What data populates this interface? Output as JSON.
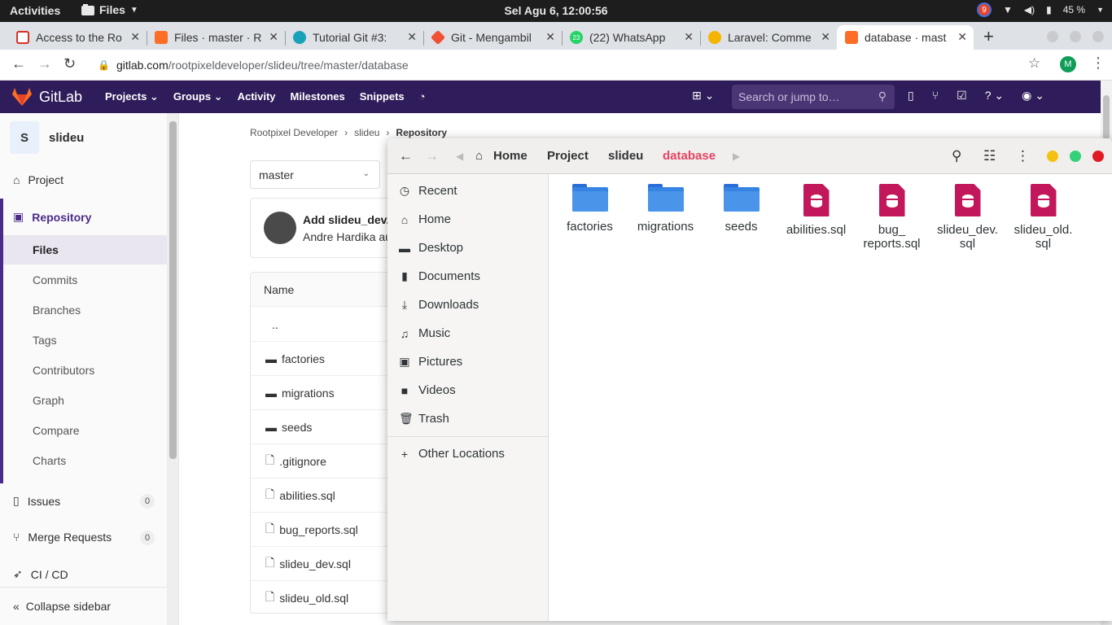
{
  "system_bar": {
    "activities": "Activities",
    "app_menu": "Files",
    "clock": "Sel Agu  6, 12:00:56",
    "notification_count": "9",
    "battery": "45 %"
  },
  "browser": {
    "tabs": [
      {
        "title": "Access to the Ro"
      },
      {
        "title": "Files · master · R"
      },
      {
        "title": "Tutorial Git #3:"
      },
      {
        "title": "Git - Mengambil"
      },
      {
        "title": "(22) WhatsApp"
      },
      {
        "title": "Laravel: Comme"
      },
      {
        "title": "database · mast"
      }
    ],
    "whatsapp_badge": "23",
    "url_host": "gitlab.com",
    "url_path": "/rootpixeldeveloper/slideu/tree/master/database",
    "profile_initial": "M"
  },
  "gitlab": {
    "brand": "GitLab",
    "nav": [
      "Projects",
      "Groups",
      "Activity",
      "Milestones",
      "Snippets"
    ],
    "search_placeholder": "Search or jump to…",
    "project_initial": "S",
    "project_name": "slideu",
    "sidebar": {
      "project": "Project",
      "repository": "Repository",
      "sub": [
        "Files",
        "Commits",
        "Branches",
        "Tags",
        "Contributors",
        "Graph",
        "Compare",
        "Charts"
      ],
      "issues": "Issues",
      "issues_count": "0",
      "merge_requests": "Merge Requests",
      "mr_count": "0",
      "cicd": "CI / CD",
      "collapse": "Collapse sidebar"
    },
    "breadcrumb": [
      "Rootpixel Developer",
      "slideu",
      "Repository"
    ],
    "branch": "master",
    "commit_message": "Add slideu_dev.",
    "commit_author": "Andre Hardika au",
    "table_header": "Name",
    "files": [
      {
        "name": "..",
        "type": "parent"
      },
      {
        "name": "factories",
        "type": "folder"
      },
      {
        "name": "migrations",
        "type": "folder"
      },
      {
        "name": "seeds",
        "type": "folder"
      },
      {
        "name": ".gitignore",
        "type": "file"
      },
      {
        "name": "abilities.sql",
        "type": "file"
      },
      {
        "name": "bug_reports.sql",
        "type": "file"
      },
      {
        "name": "slideu_dev.sql",
        "type": "file"
      },
      {
        "name": "slideu_old.sql",
        "type": "file"
      }
    ]
  },
  "files_app": {
    "path": [
      "Home",
      "Project",
      "slideu",
      "database"
    ],
    "places": [
      "Recent",
      "Home",
      "Desktop",
      "Documents",
      "Downloads",
      "Music",
      "Pictures",
      "Videos",
      "Trash"
    ],
    "other_locations": "Other Locations",
    "items": [
      {
        "line1": "factories",
        "line2": "",
        "type": "folder"
      },
      {
        "line1": "migrations",
        "line2": "",
        "type": "folder"
      },
      {
        "line1": "seeds",
        "line2": "",
        "type": "folder"
      },
      {
        "line1": "abilities.sql",
        "line2": "",
        "type": "sql"
      },
      {
        "line1": "bug_",
        "line2": "reports.sql",
        "type": "sql"
      },
      {
        "line1": "slideu_dev.",
        "line2": "sql",
        "type": "sql"
      },
      {
        "line1": "slideu_old.",
        "line2": "sql",
        "type": "sql"
      }
    ]
  },
  "colors": {
    "gitlab_header": "#2f1c5a",
    "breadcrumb_current": "#e54363",
    "folder_blue": "#3584e4",
    "sql_icon": "#c2185b"
  }
}
